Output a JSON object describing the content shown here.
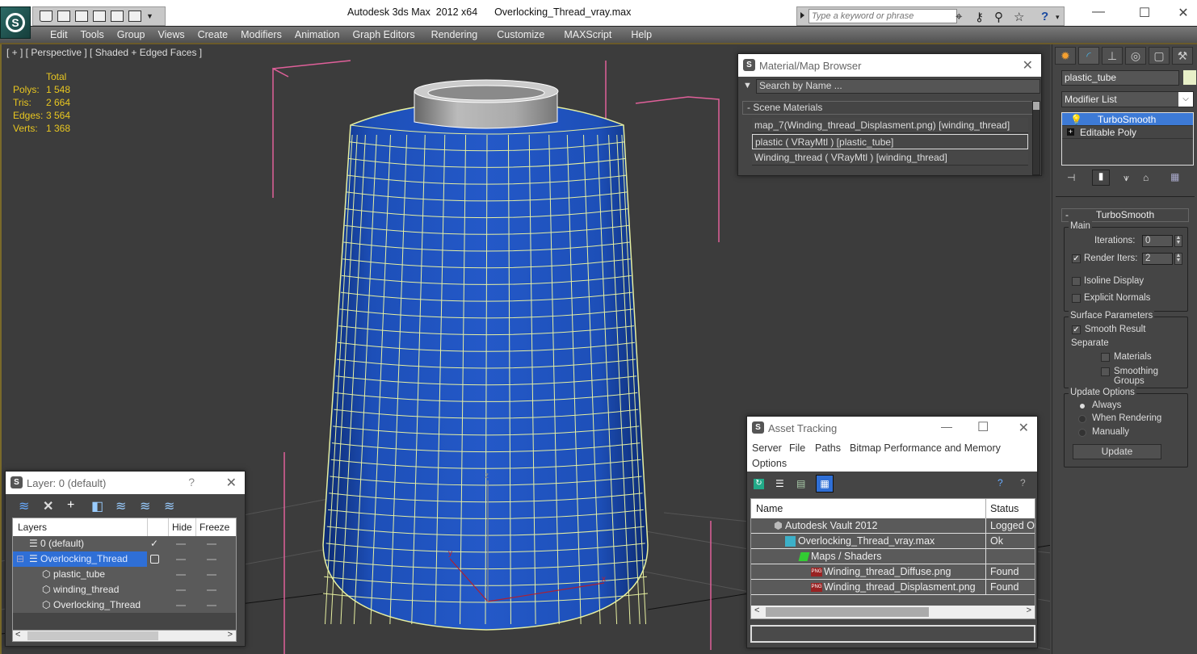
{
  "titlebar": {
    "app_title": "Autodesk 3ds Max  2012 x64",
    "file_name": "Overlocking_Thread_vray.max",
    "search_placeholder": "Type a keyword or phrase",
    "minimize": "—",
    "maximize": "☐",
    "close": "✕"
  },
  "menu": [
    "Edit",
    "Tools",
    "Group",
    "Views",
    "Create",
    "Modifiers",
    "Animation",
    "Graph Editors",
    "Rendering",
    "Customize",
    "MAXScript",
    "Help"
  ],
  "viewport": {
    "label": "[ + ] [ Perspective ] [ Shaded + Edged Faces ]",
    "stats_header": "Total",
    "stats": [
      {
        "label": "Polys:",
        "value": "1 548"
      },
      {
        "label": "Tris:",
        "value": "2 664"
      },
      {
        "label": "Edges:",
        "value": "3 564"
      },
      {
        "label": "Verts:",
        "value": "1 368"
      }
    ],
    "axis": {
      "x": "x",
      "y": "y",
      "z": "z"
    }
  },
  "material_browser": {
    "title": "Material/Map Browser",
    "search_placeholder": "Search by Name ...",
    "section": "- Scene Materials",
    "materials": [
      "map_7(Winding_thread_Displasment.png) [winding_thread]",
      "plastic  ( VRayMtl ) [plastic_tube]",
      "Winding_thread  ( VRayMtl ) [winding_thread]"
    ]
  },
  "command_panel": {
    "object_name": "plastic_tube",
    "object_color": "#e8f0c8",
    "modifier_list": "Modifier List",
    "stack": [
      "TurboSmooth",
      "Editable Poly"
    ],
    "rollout": "TurboSmooth",
    "main_group": "Main",
    "iterations_label": "Iterations:",
    "iterations_value": "0",
    "render_iters_label": "Render Iters:",
    "render_iters_value": "2",
    "render_iters_checked": true,
    "isoline_label": "Isoline Display",
    "explicit_label": "Explicit Normals",
    "surface_group": "Surface Parameters",
    "smooth_result_label": "Smooth Result",
    "separate_label": "Separate",
    "materials_label": "Materials",
    "smoothing_groups_label": "Smoothing Groups",
    "update_group": "Update Options",
    "update_always": "Always",
    "update_rendering": "When Rendering",
    "update_manually": "Manually",
    "update_button": "Update"
  },
  "layer_window": {
    "title": "Layer: 0 (default)",
    "help": "?",
    "close": "✕",
    "col_layers": "Layers",
    "col_hide": "Hide",
    "col_freeze": "Freeze",
    "rows": [
      {
        "name": "0 (default)",
        "level": 0,
        "current": true
      },
      {
        "name": "Overlocking_Thread",
        "level": 0,
        "selected": true
      },
      {
        "name": "plastic_tube",
        "level": 1
      },
      {
        "name": "winding_thread",
        "level": 1
      },
      {
        "name": "Overlocking_Thread",
        "level": 1
      }
    ]
  },
  "asset_tracking": {
    "title": "Asset Tracking",
    "menu": [
      "Server",
      "File",
      "Paths",
      "Bitmap Performance and Memory",
      "Options"
    ],
    "col_name": "Name",
    "col_status": "Status",
    "rows": [
      {
        "name": "Autodesk Vault 2012",
        "status": "Logged Ou",
        "icon": "vault-icon"
      },
      {
        "name": "Overlocking_Thread_vray.max",
        "status": "Ok",
        "icon": "max-file-icon"
      },
      {
        "name": "Maps / Shaders",
        "status": "",
        "icon": "maps-icon"
      },
      {
        "name": "Winding_thread_Diffuse.png",
        "status": "Found",
        "icon": "png-icon"
      },
      {
        "name": "Winding_thread_Displasment.png",
        "status": "Found",
        "icon": "png-icon"
      }
    ]
  }
}
